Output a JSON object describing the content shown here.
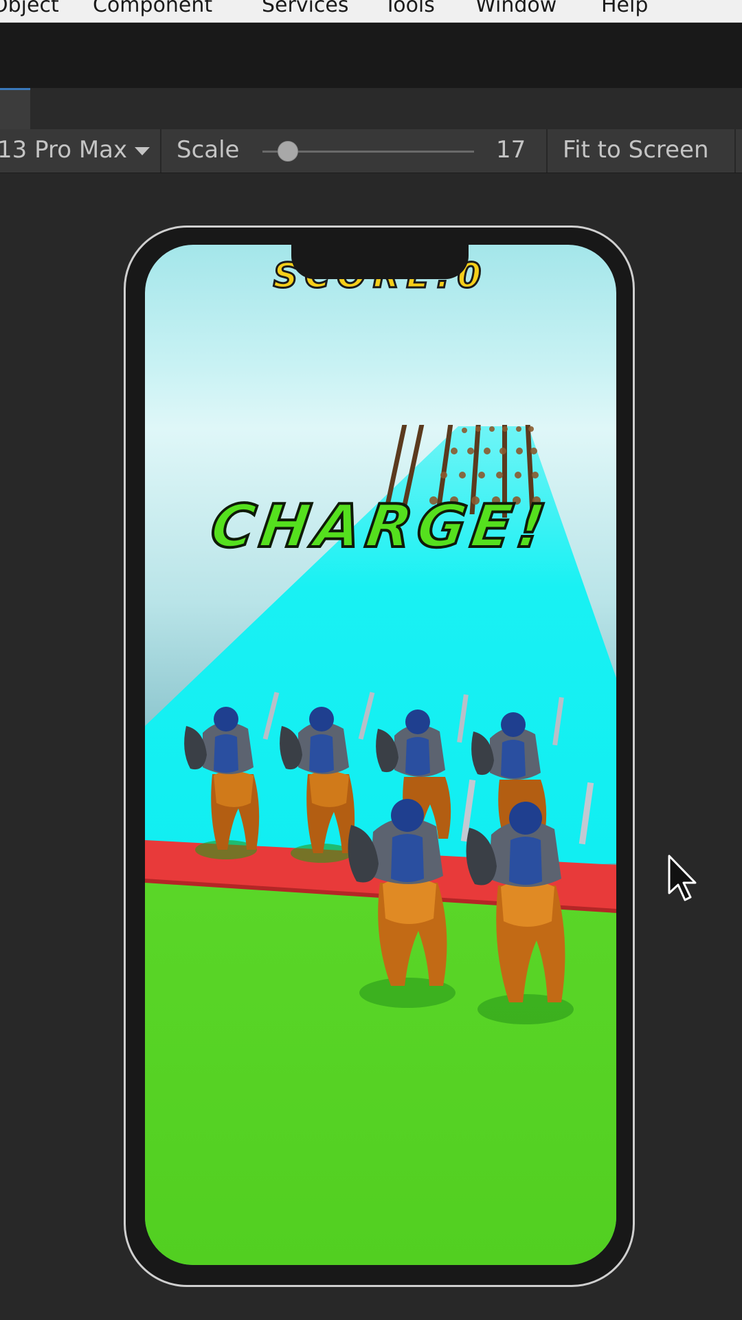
{
  "menu": {
    "items": [
      "Object",
      "Component",
      "Services",
      "Tools",
      "Window",
      "Help"
    ]
  },
  "game_toolbar": {
    "device_label": "13 Pro Max",
    "scale_label": "Scale",
    "scale_value": "17",
    "scale_slider_level": 0.1,
    "fit_label": "Fit to Screen"
  },
  "game": {
    "score_text": "SCORE:0",
    "charge_text": "CHARGE!",
    "colors": {
      "sky_top": "#a4e6ea",
      "track": "#17f0f2",
      "red_line": "#e83a3a",
      "grass": "#55d124",
      "knight_armor": "#2a4fa0",
      "horse": "#c26a15"
    }
  }
}
